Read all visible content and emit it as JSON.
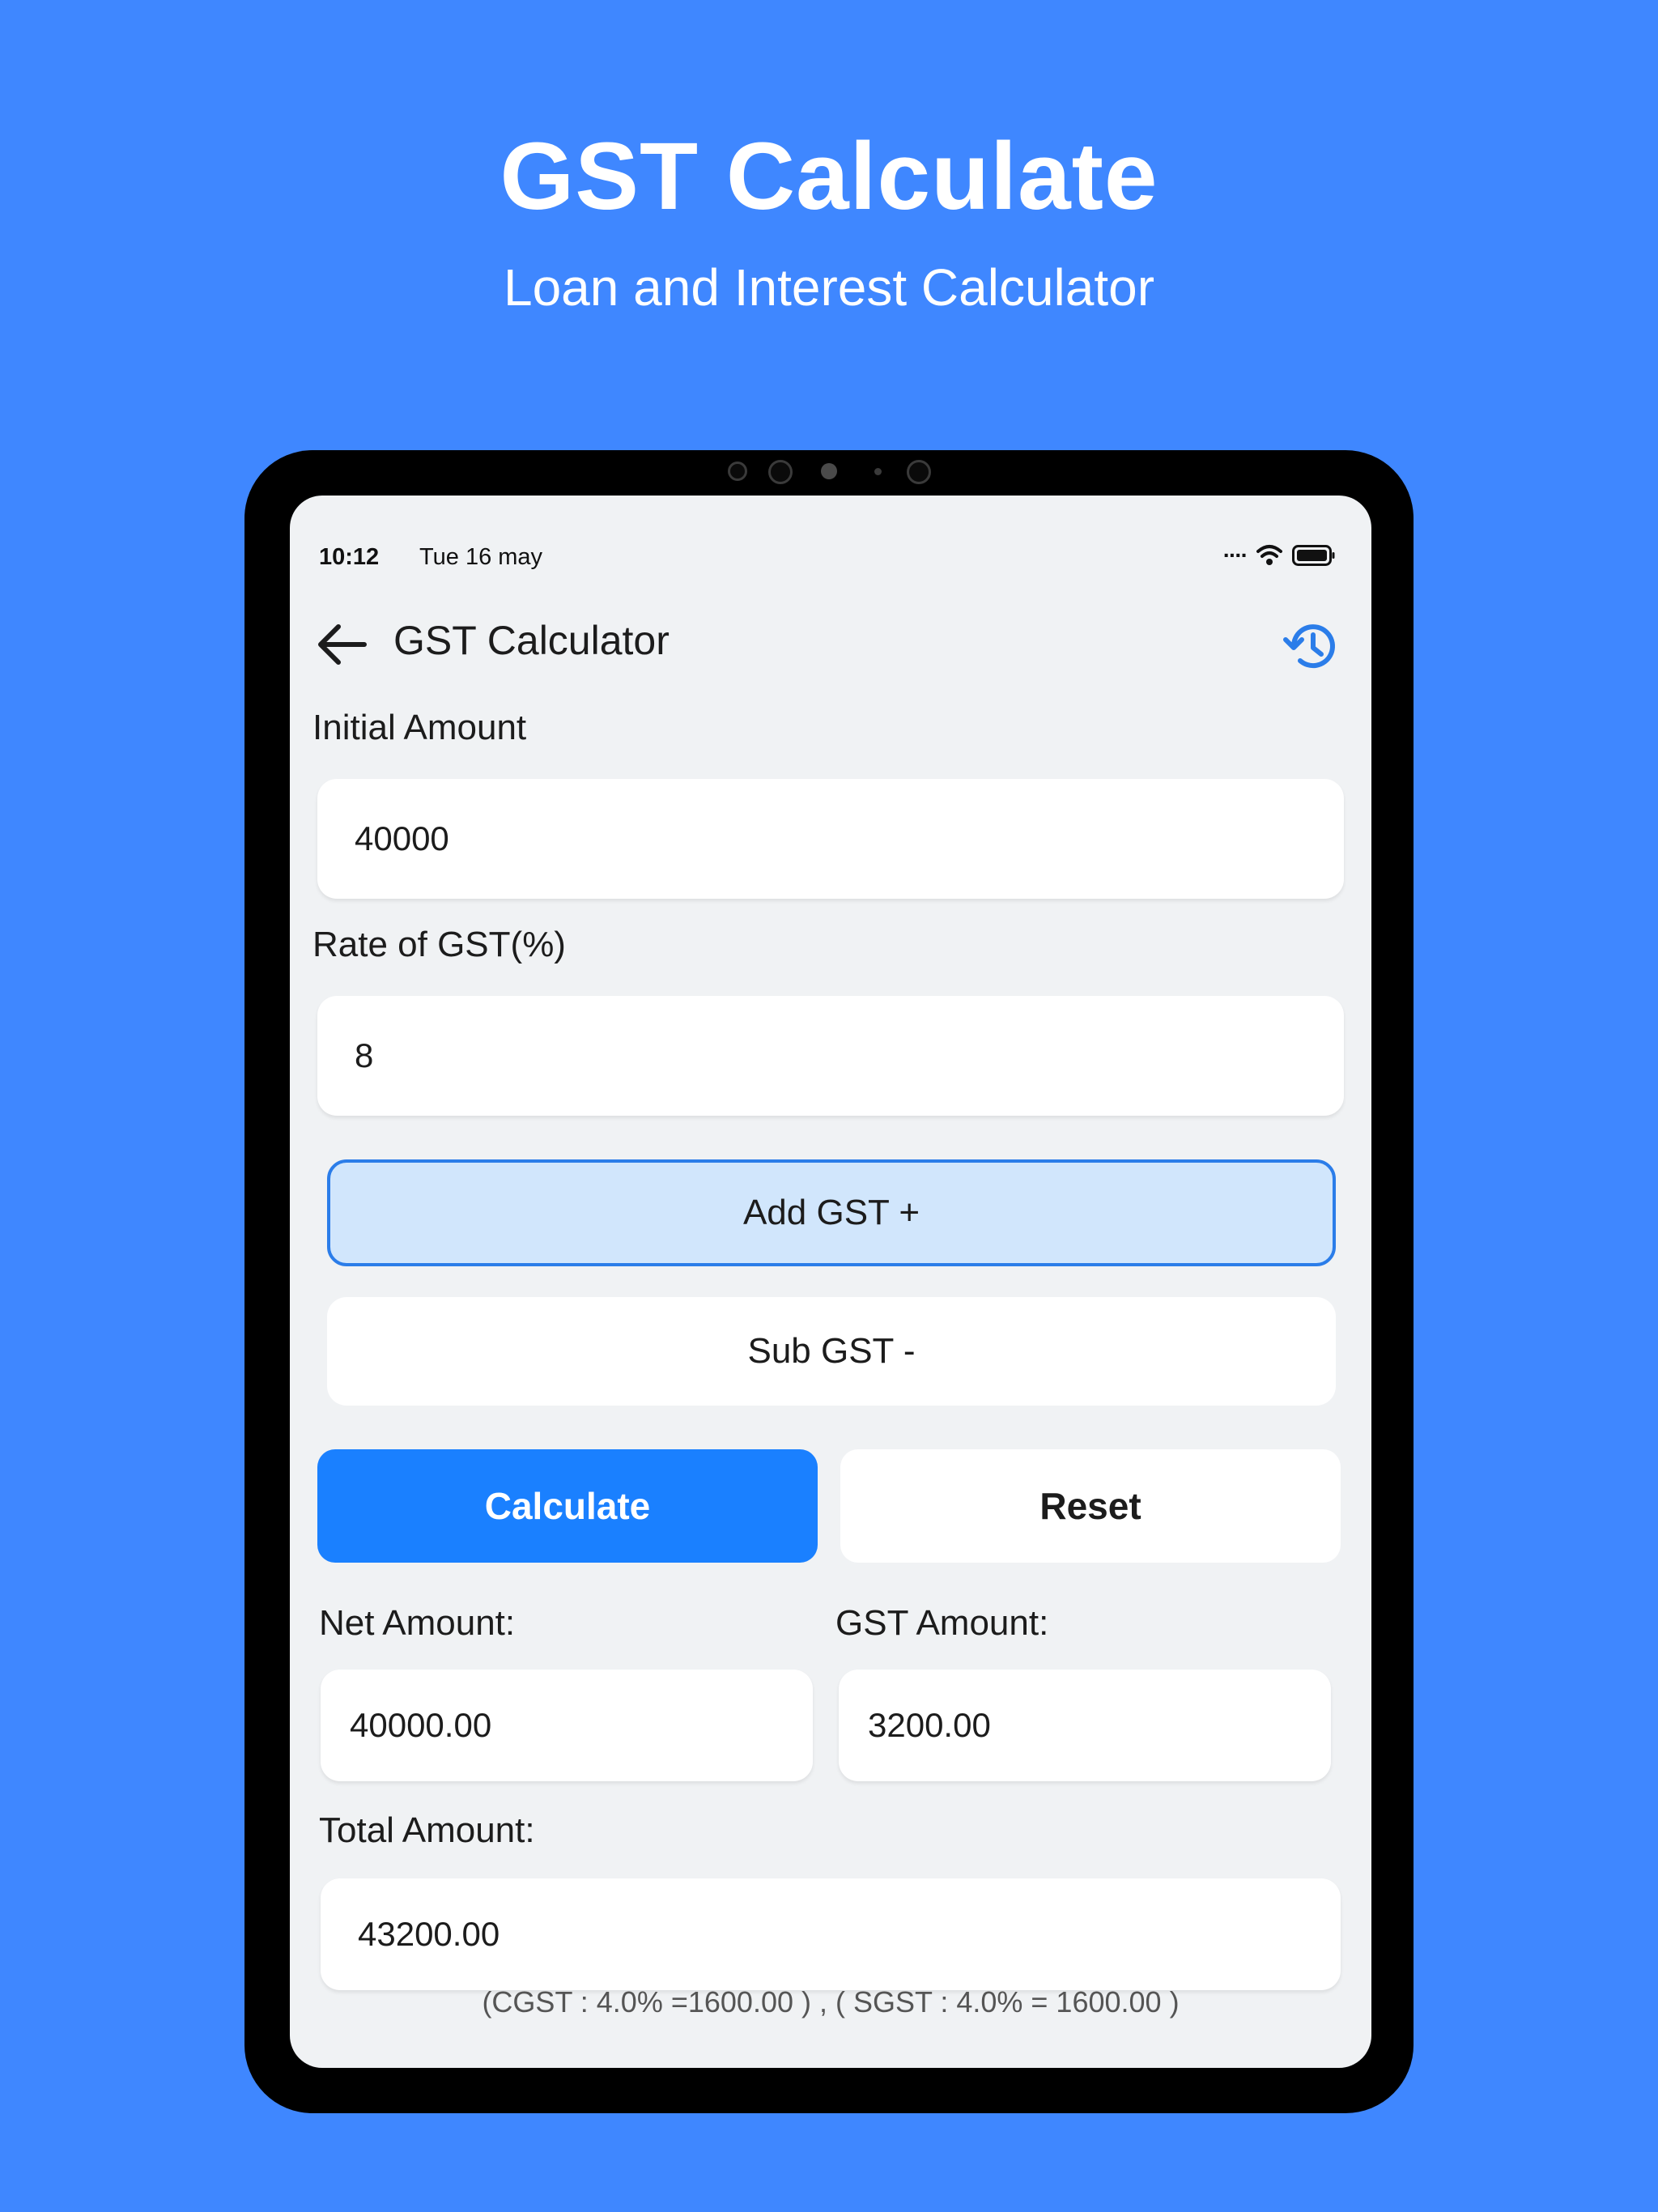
{
  "hero": {
    "title": "GST Calculate",
    "subtitle": "Loan and Interest Calculator"
  },
  "status_bar": {
    "time": "10:12",
    "date": "Tue 16 may",
    "icons": [
      "signal-dots-icon",
      "wifi-icon",
      "battery-icon"
    ]
  },
  "app_bar": {
    "title": "GST Calculator",
    "back_icon": "arrow-left-icon",
    "history_icon": "history-icon"
  },
  "form": {
    "initial_amount_label": "Initial Amount",
    "initial_amount_value": "40000",
    "rate_label": "Rate of GST(%)",
    "rate_value": "8",
    "add_gst_label": "Add GST +",
    "sub_gst_label": "Sub GST -",
    "selected_mode": "Add GST +"
  },
  "actions": {
    "calculate_label": "Calculate",
    "reset_label": "Reset"
  },
  "results": {
    "net_amount_label": "Net Amount:",
    "net_amount_value": "40000.00",
    "gst_amount_label": "GST Amount:",
    "gst_amount_value": "3200.00",
    "total_amount_label": "Total Amount:",
    "total_amount_value": "43200.00",
    "breakdown": "(CGST : 4.0% =1600.00 ) , ( SGST : 4.0% = 1600.00 )"
  },
  "colors": {
    "background": "#3f87ff",
    "accent": "#1a80ff",
    "selected_fill": "#d1e6fc",
    "selected_border": "#2b7de9",
    "screen_bg": "#f0f2f4"
  }
}
